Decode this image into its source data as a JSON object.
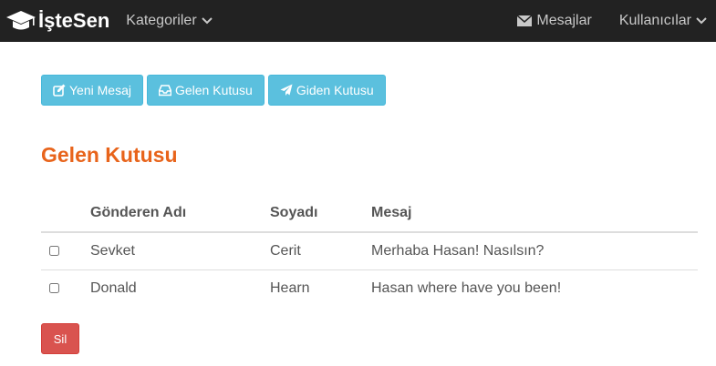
{
  "navbar": {
    "brand": "İşteSen",
    "brand_icon": "graduation-cap-icon",
    "categories_label": "Kategoriler",
    "messages_label": "Mesajlar",
    "users_label": "Kullanıcılar"
  },
  "toolbar": {
    "new_message_label": "Yeni Mesaj",
    "inbox_label": "Gelen Kutusu",
    "outbox_label": "Giden Kutusu"
  },
  "page_title": "Gelen Kutusu",
  "table": {
    "headers": [
      "",
      "Gönderen Adı",
      "Soyadı",
      "Mesaj"
    ],
    "rows": [
      {
        "checked": false,
        "first_name": "Sevket",
        "last_name": "Cerit",
        "message": "Merhaba Hasan! Nasılsın?"
      },
      {
        "checked": false,
        "first_name": "Donald",
        "last_name": "Hearn",
        "message": "Hasan where have you been!"
      }
    ]
  },
  "delete_label": "Sil",
  "colors": {
    "navbar_bg": "#222222",
    "info_button": "#5bc0de",
    "danger_button": "#d9534f",
    "title": "#e8641b"
  }
}
